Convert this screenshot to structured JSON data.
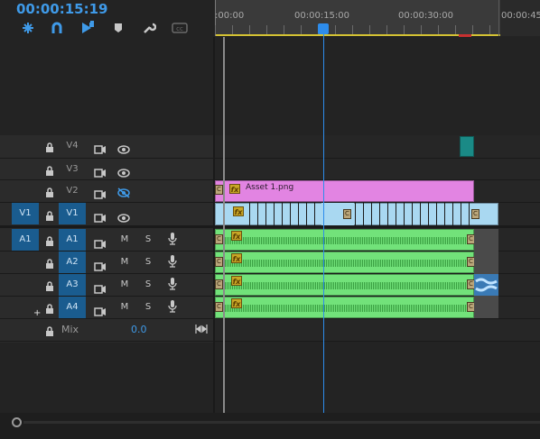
{
  "timecode": "00:00:15:19",
  "ruler": {
    "labels": [
      ":00:00",
      "00:00:15:00",
      "00:00:30:00",
      "00:00:45"
    ],
    "playhead_time": "00:00:15:19"
  },
  "tools": [
    {
      "name": "snap-icon",
      "active": true
    },
    {
      "name": "linked-selection-icon",
      "active": true
    },
    {
      "name": "add-marker-icon",
      "active": true
    },
    {
      "name": "marker-icon",
      "active": false
    },
    {
      "name": "wrench-icon",
      "active": false
    },
    {
      "name": "captions-icon",
      "active": false
    }
  ],
  "video_tracks": [
    {
      "id": "V4",
      "source": "",
      "lock": true,
      "eye": "visible"
    },
    {
      "id": "V3",
      "source": "",
      "lock": true,
      "eye": "visible"
    },
    {
      "id": "V2",
      "source": "",
      "lock": true,
      "eye": "hidden"
    },
    {
      "id": "V1",
      "source": "V1",
      "lock": true,
      "eye": "visible",
      "targeted": true
    }
  ],
  "audio_tracks": [
    {
      "id": "A1",
      "source": "A1",
      "targeted": true,
      "mute": "M",
      "solo": "S"
    },
    {
      "id": "A2",
      "source": "",
      "targeted": true,
      "mute": "M",
      "solo": "S"
    },
    {
      "id": "A3",
      "source": "",
      "targeted": true,
      "mute": "M",
      "solo": "S"
    },
    {
      "id": "A4",
      "source": "",
      "targeted": true,
      "mute": "M",
      "solo": "S"
    }
  ],
  "mix": {
    "label": "Mix",
    "value": "0.0"
  },
  "clips": {
    "v2_clip_name": "Asset 1.png",
    "fx_label": "fx",
    "c_label": "C"
  },
  "colors": {
    "accent": "#3f9ae8",
    "clip_pink": "#e284e2",
    "clip_blue": "#a9d8f1",
    "clip_green": "#72e27a",
    "clip_teal": "#1a8a86",
    "patch_blue": "#1a5c8f"
  }
}
